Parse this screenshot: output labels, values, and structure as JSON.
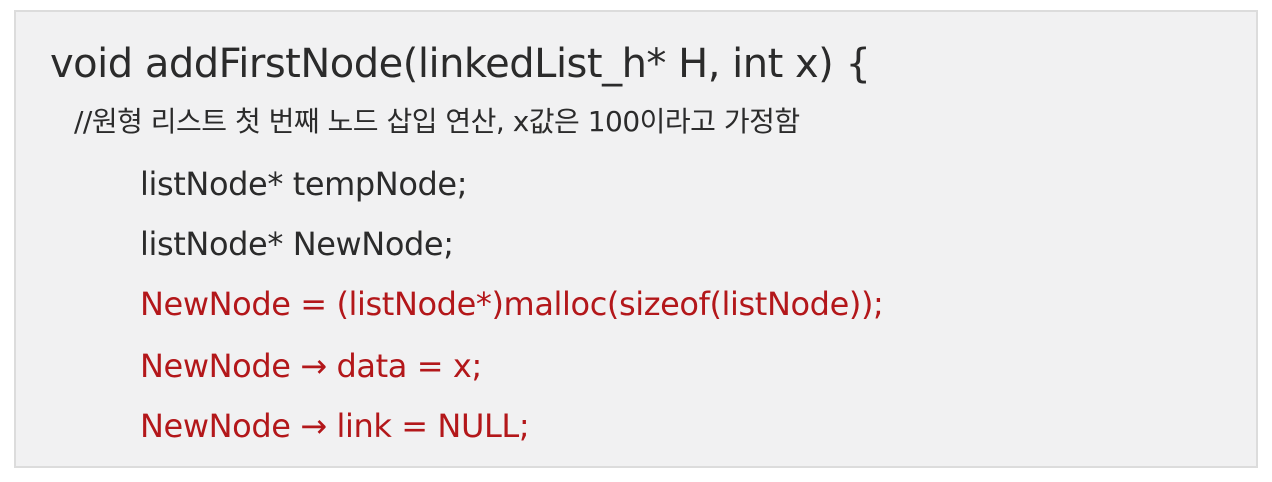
{
  "code": {
    "signature": "void addFirstNode(linkedList_h* H, int x) {",
    "comment": "//원형 리스트 첫 번째 노드 삽입 연산, x값은 100이라고 가정함",
    "lines": [
      "listNode* tempNode;",
      "listNode* NewNode;",
      "NewNode = (listNode*)malloc(sizeof(listNode));",
      "NewNode → data = x;",
      "NewNode → link = NULL;"
    ]
  },
  "colors": {
    "default_text": "#2b2b2b",
    "highlight_text": "#b3171a",
    "box_background": "#f1f1f2",
    "box_border": "#dcdcdc"
  }
}
